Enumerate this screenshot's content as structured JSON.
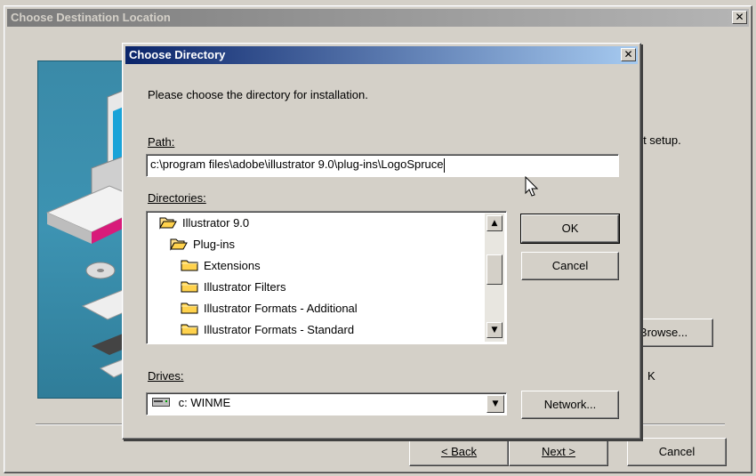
{
  "background_window": {
    "title": "Choose Destination Location",
    "close_glyph": "✕",
    "exit_text_fragment": "to exit setup.",
    "browse_label": "Browse...",
    "space_fragment": "K",
    "back_label": "< Back",
    "next_label": "Next >",
    "cancel_label": "Cancel"
  },
  "dialog": {
    "title": "Choose Directory",
    "close_glyph": "✕",
    "instruction": "Please choose the directory for installation.",
    "path_label": "Path:",
    "path_value": "c:\\program files\\adobe\\illustrator 9.0\\plug-ins\\LogoSpruce",
    "directories_label": "Directories:",
    "directories": [
      {
        "label": "Illustrator 9.0",
        "indent": 0,
        "open": true
      },
      {
        "label": "Plug-ins",
        "indent": 1,
        "open": true
      },
      {
        "label": "Extensions",
        "indent": 2,
        "open": false
      },
      {
        "label": "Illustrator Filters",
        "indent": 2,
        "open": false
      },
      {
        "label": "Illustrator Formats - Additional",
        "indent": 2,
        "open": false
      },
      {
        "label": "Illustrator Formats - Standard",
        "indent": 2,
        "open": false
      }
    ],
    "ok_label": "OK",
    "cancel_label": "Cancel",
    "drives_label": "Drives:",
    "drive_value": "c: WINME",
    "network_label": "Network...",
    "scroll_up_glyph": "▲",
    "scroll_down_glyph": "▼",
    "dropdown_glyph": "▼"
  },
  "colors": {
    "face": "#d4d0c8",
    "title_active": "#0a246a",
    "illustration_bg": "#3a8aa8"
  }
}
